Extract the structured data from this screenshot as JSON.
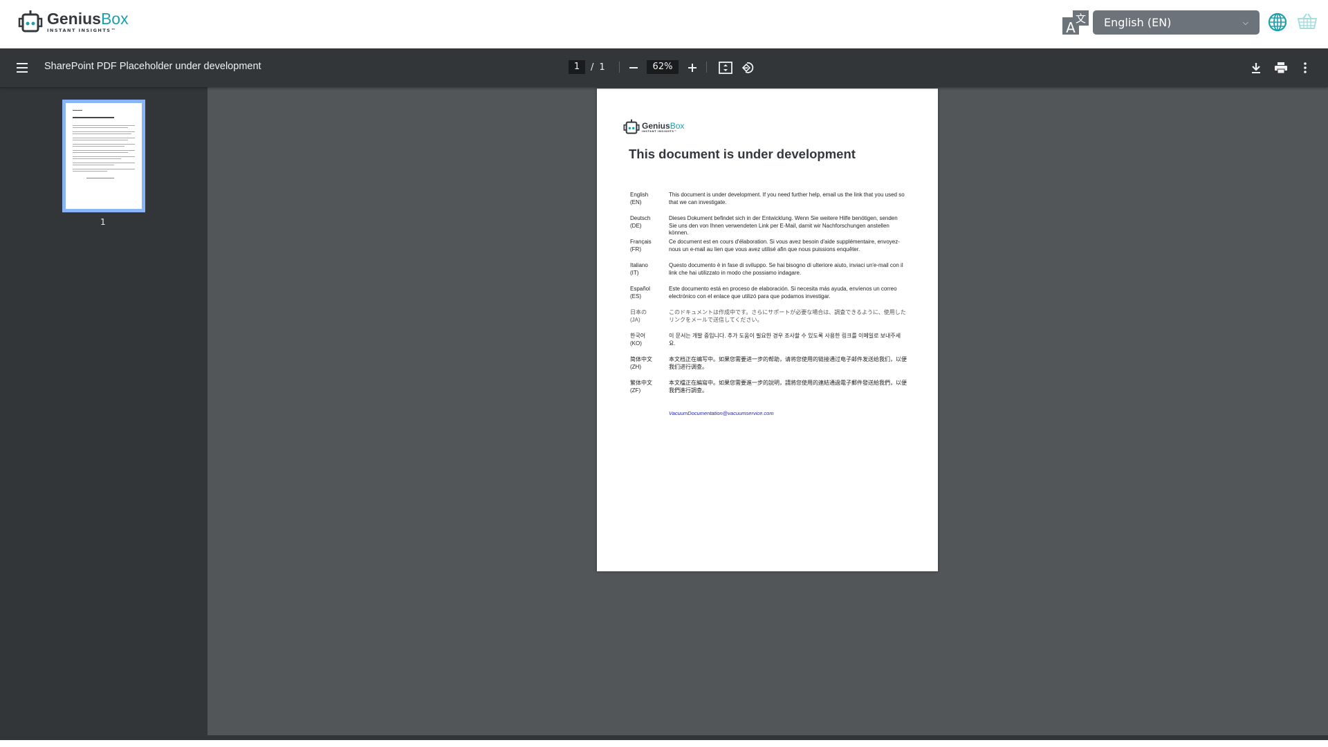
{
  "header": {
    "logo_main": "Genius",
    "logo_accent": "Box",
    "logo_tagline": "INSTANT INSIGHTS™",
    "language_selected": "English (EN)"
  },
  "toolbar": {
    "title": "SharePoint PDF Placeholder under development",
    "page_current": "1",
    "page_separator": "/",
    "page_total": "1",
    "zoom": "62%"
  },
  "sidebar": {
    "thumbnail_label": "1"
  },
  "document": {
    "title": "This document is under development",
    "rows": [
      {
        "lang": "English",
        "code": "(EN)",
        "text": "This document is under development. If you need further help, email us the link that you used so that we can investigate."
      },
      {
        "lang": "Deutsch",
        "code": "(DE)",
        "text": "Dieses Dokument befindet sich in der Entwicklung. Wenn Sie weitere Hilfe benötigen, senden Sie uns den von Ihnen verwendeten Link per E-Mail, damit wir Nachforschungen anstellen können."
      },
      {
        "lang": "Français",
        "code": "(FR)",
        "text": "Ce document est en cours d'élaboration. Si vous avez besoin d'aide supplémentaire, envoyez-nous un e-mail au lien que vous avez utilisé afin que nous puissions enquêter."
      },
      {
        "lang": "Italiano",
        "code": "(IT)",
        "text": "Questo documento è in fase di sviluppo. Se hai bisogno di ulteriore aiuto, inviaci un'e-mail con il link che hai utilizzato in modo che possiamo indagare."
      },
      {
        "lang": "Español",
        "code": "(ES)",
        "text": "Este documento está en proceso de elaboración. Si necesita más ayuda, envíenos un correo electrónico con el enlace que utilizó para que podamos investigar."
      },
      {
        "lang": "日本の",
        "code": "(JA)",
        "text": "このドキュメントは作成中です。さらにサポートが必要な場合は、調査できるように、使用したリンクをメールで送信してください。"
      },
      {
        "lang": "한국어",
        "code": "(KO)",
        "text": "이 문서는 개발 중입니다. 추가 도움이 필요한 경우 조사할 수 있도록 사용한 링크를 이메일로 보내주세요."
      },
      {
        "lang": "简体中文",
        "code": "(ZH)",
        "text": "本文档正在编写中。如果您需要进一步的帮助，请将您使用的链接通过电子邮件发送给我们，以便我们进行调查。"
      },
      {
        "lang": "繁体中文",
        "code": "(ZF)",
        "text": "本文檔正在編寫中。如果您需要進一步的說明，請將您使用的連結通過電子郵件發送給我們，以便我們進行調查。"
      }
    ],
    "email": "VacuumDocumentation@vacuumservice.com"
  },
  "colors": {
    "accent": "#1aa0aa",
    "toolbar": "#323639",
    "viewer": "#525659",
    "select": "#6c737a"
  }
}
